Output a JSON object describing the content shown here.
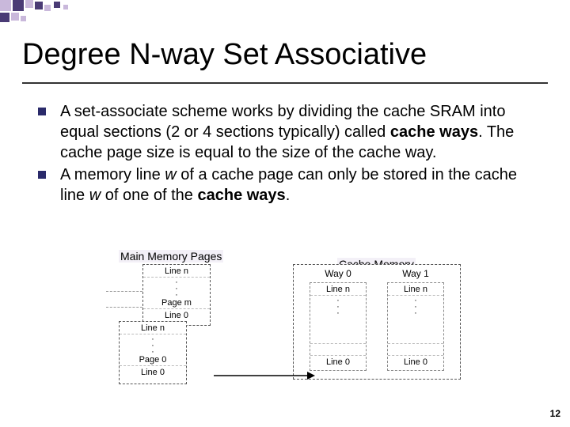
{
  "title": "Degree N-way Set Associative",
  "bullets": [
    {
      "pre": "A set-associate scheme works by dividing the cache SRAM into equal sections (2 or 4 sections typically) called ",
      "b1": "cache ways",
      "mid": ". The cache page size is equal to the size of the cache way.",
      "post": ""
    },
    {
      "pre": "A memory line ",
      "i1": "w",
      "mid": " of a cache page can only be stored in the cache line ",
      "i2": "w",
      "mid2": " of  one of the ",
      "b1": "cache ways",
      "post": "."
    }
  ],
  "diagram": {
    "mainLabel": "Main Memory Pages",
    "cacheLabel": "Cache Memory",
    "lineN": "Line n",
    "line0": "Line 0",
    "pageM": "Page m",
    "page0": "Page 0",
    "way0": "Way 0",
    "way1": "Way 1"
  },
  "pageNumber": "12"
}
